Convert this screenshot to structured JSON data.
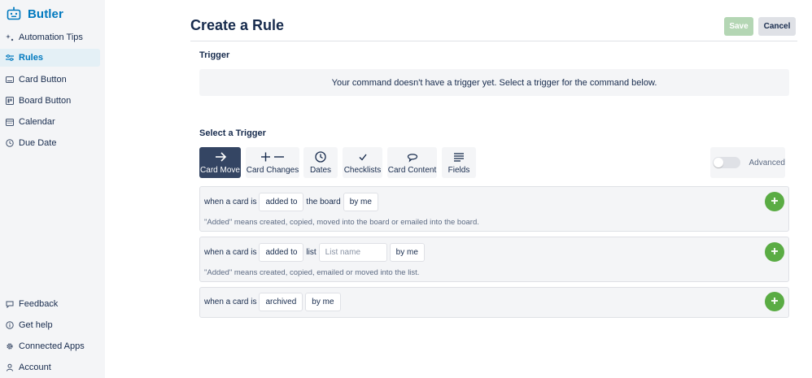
{
  "sidebar": {
    "brand": "Butler",
    "brand_color": "#0079bf",
    "items": [
      {
        "label": "Automation Tips",
        "icon": "sparkle-icon"
      },
      {
        "label": "Rules",
        "icon": "sliders-icon",
        "active": true
      },
      {
        "label": "Card Button",
        "icon": "card-button-icon"
      },
      {
        "label": "Board Button",
        "icon": "board-button-icon"
      },
      {
        "label": "Calendar",
        "icon": "calendar-icon"
      },
      {
        "label": "Due Date",
        "icon": "clock-icon"
      }
    ],
    "footer_items": [
      {
        "label": "Feedback",
        "icon": "speech-bubble-icon"
      },
      {
        "label": "Get help",
        "icon": "help-icon"
      },
      {
        "label": "Connected Apps",
        "icon": "gear-icon"
      },
      {
        "label": "Account",
        "icon": "user-icon"
      }
    ]
  },
  "header": {
    "title": "Create a Rule",
    "save_label": "Save",
    "cancel_label": "Cancel"
  },
  "trigger": {
    "heading": "Trigger",
    "empty_message": "Your command doesn't have a trigger yet. Select a trigger for the command below."
  },
  "select_trigger": {
    "heading": "Select a Trigger",
    "tabs": [
      {
        "label": "Card Move",
        "icon": "arrow-right-icon",
        "active": true
      },
      {
        "label": "Card Changes",
        "icon": "plus-minus-icon"
      },
      {
        "label": "Dates",
        "icon": "clock-icon"
      },
      {
        "label": "Checklists",
        "icon": "checkmark-icon"
      },
      {
        "label": "Card Content",
        "icon": "comment-icon"
      },
      {
        "label": "Fields",
        "icon": "lines-icon"
      }
    ],
    "advanced_label": "Advanced",
    "advanced_enabled": false
  },
  "rules": [
    {
      "prefix": "when a card is",
      "action": "added to",
      "middle": "the board",
      "actor": "by me",
      "note": "\"Added\" means created, copied, moved into the board or emailed into the board."
    },
    {
      "prefix": "when a card is",
      "action": "added to",
      "middle": "list",
      "input_placeholder": "List name",
      "actor": "by me",
      "note": "\"Added\" means created, copied, emailed or moved into the list."
    },
    {
      "prefix": "when a card is",
      "action": "archived",
      "actor": "by me"
    }
  ],
  "colors": {
    "accent": "#0079bf",
    "add_button": "#5aac44",
    "active_tab": "#344563",
    "save_disabled": "#b4d6b4"
  }
}
